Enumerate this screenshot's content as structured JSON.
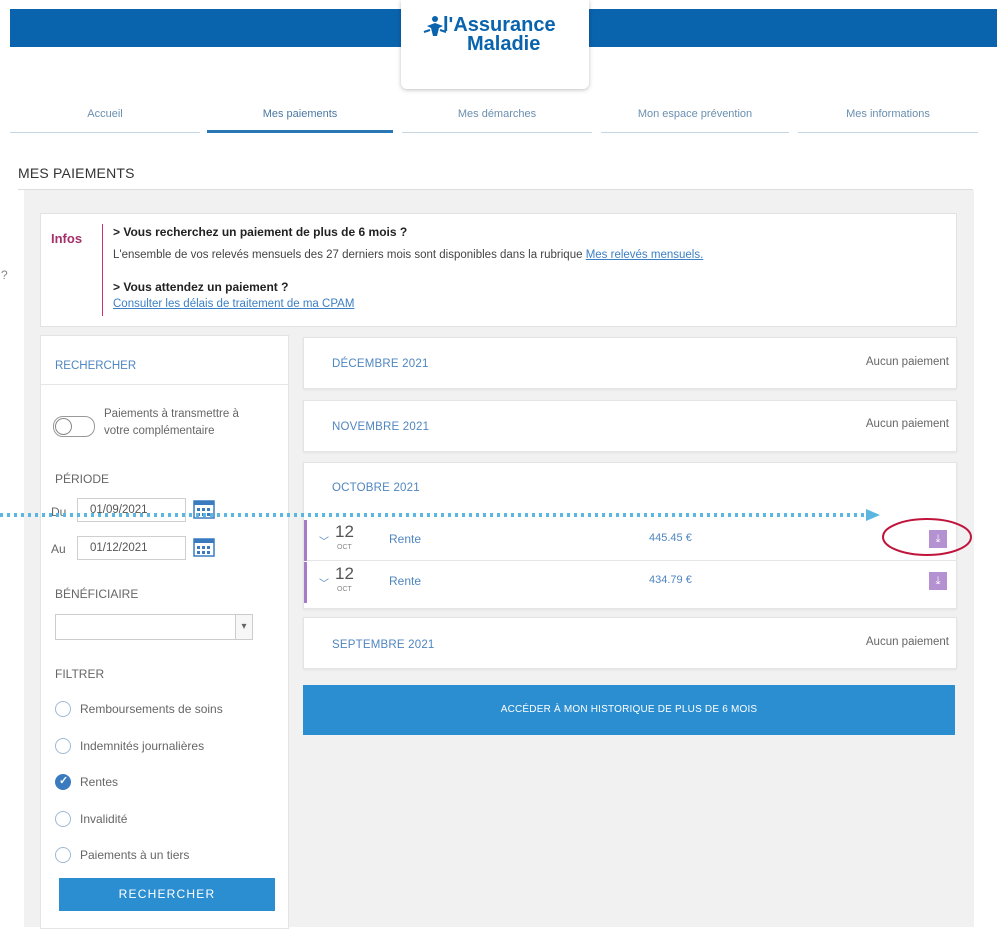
{
  "header": {
    "logo_line1": "l'Assurance",
    "logo_line2": "Maladie",
    "nav_tabs": [
      {
        "label": "Accueil"
      },
      {
        "label": "Mes paiements"
      },
      {
        "label": "Mes démarches"
      },
      {
        "label": "Mon espace prévention"
      },
      {
        "label": "Mes informations"
      }
    ]
  },
  "page_title": "MES PAIEMENTS",
  "info": {
    "label": "Infos",
    "q1": "> Vous recherchez un paiement de plus de 6 mois ?",
    "t1": "L'ensemble de vos relevés mensuels des 27 derniers mois sont disponibles dans la rubrique",
    "t1_link": "Mes relevés mensuels.",
    "q2": "> Vous attendez un paiement ?",
    "t2_link": "Consulter les délais de traitement de ma CPAM"
  },
  "search": {
    "heading": "RECHERCHER",
    "toggle_label_1": "Paiements à transmettre à",
    "toggle_label_2": "votre complémentaire",
    "period_label": "PÉRIODE",
    "from_label": "Du",
    "from_value": "01/09/2021",
    "to_label": "Au",
    "to_value": "01/12/2021",
    "beneficiary_label": "BÉNÉFICIAIRE",
    "filter_label": "FILTRER",
    "filters": [
      {
        "label": "Remboursements de soins",
        "checked": false
      },
      {
        "label": "Indemnités journalières",
        "checked": false
      },
      {
        "label": "Rentes",
        "checked": true
      },
      {
        "label": "Invalidité",
        "checked": false
      },
      {
        "label": "Paiements à un tiers",
        "checked": false
      }
    ],
    "button_label": "RECHERCHER"
  },
  "months": [
    {
      "name": "DÉCEMBRE 2021",
      "status": "Aucun paiement"
    },
    {
      "name": "NOVEMBRE 2021",
      "status": "Aucun paiement"
    },
    {
      "name": "OCTOBRE 2021",
      "status": ""
    },
    {
      "name": "SEPTEMBRE 2021",
      "status": "Aucun paiement"
    }
  ],
  "october_payments": [
    {
      "day": "12",
      "month": "OCT",
      "label": "Rente",
      "amount": "445.45 €"
    },
    {
      "day": "12",
      "month": "OCT",
      "label": "Rente",
      "amount": "434.79 €"
    }
  ],
  "history_button": "ACCÉDER À MON HISTORIQUE DE PLUS DE 6 MOIS",
  "left_edge_glyph": "?",
  "colors": {
    "brand_blue": "#0a64ad",
    "button_blue": "#2b8ed1",
    "accent_purple": "#b491d0",
    "highlight_red": "#c0143c",
    "arrow_blue": "#5bb6e0"
  }
}
